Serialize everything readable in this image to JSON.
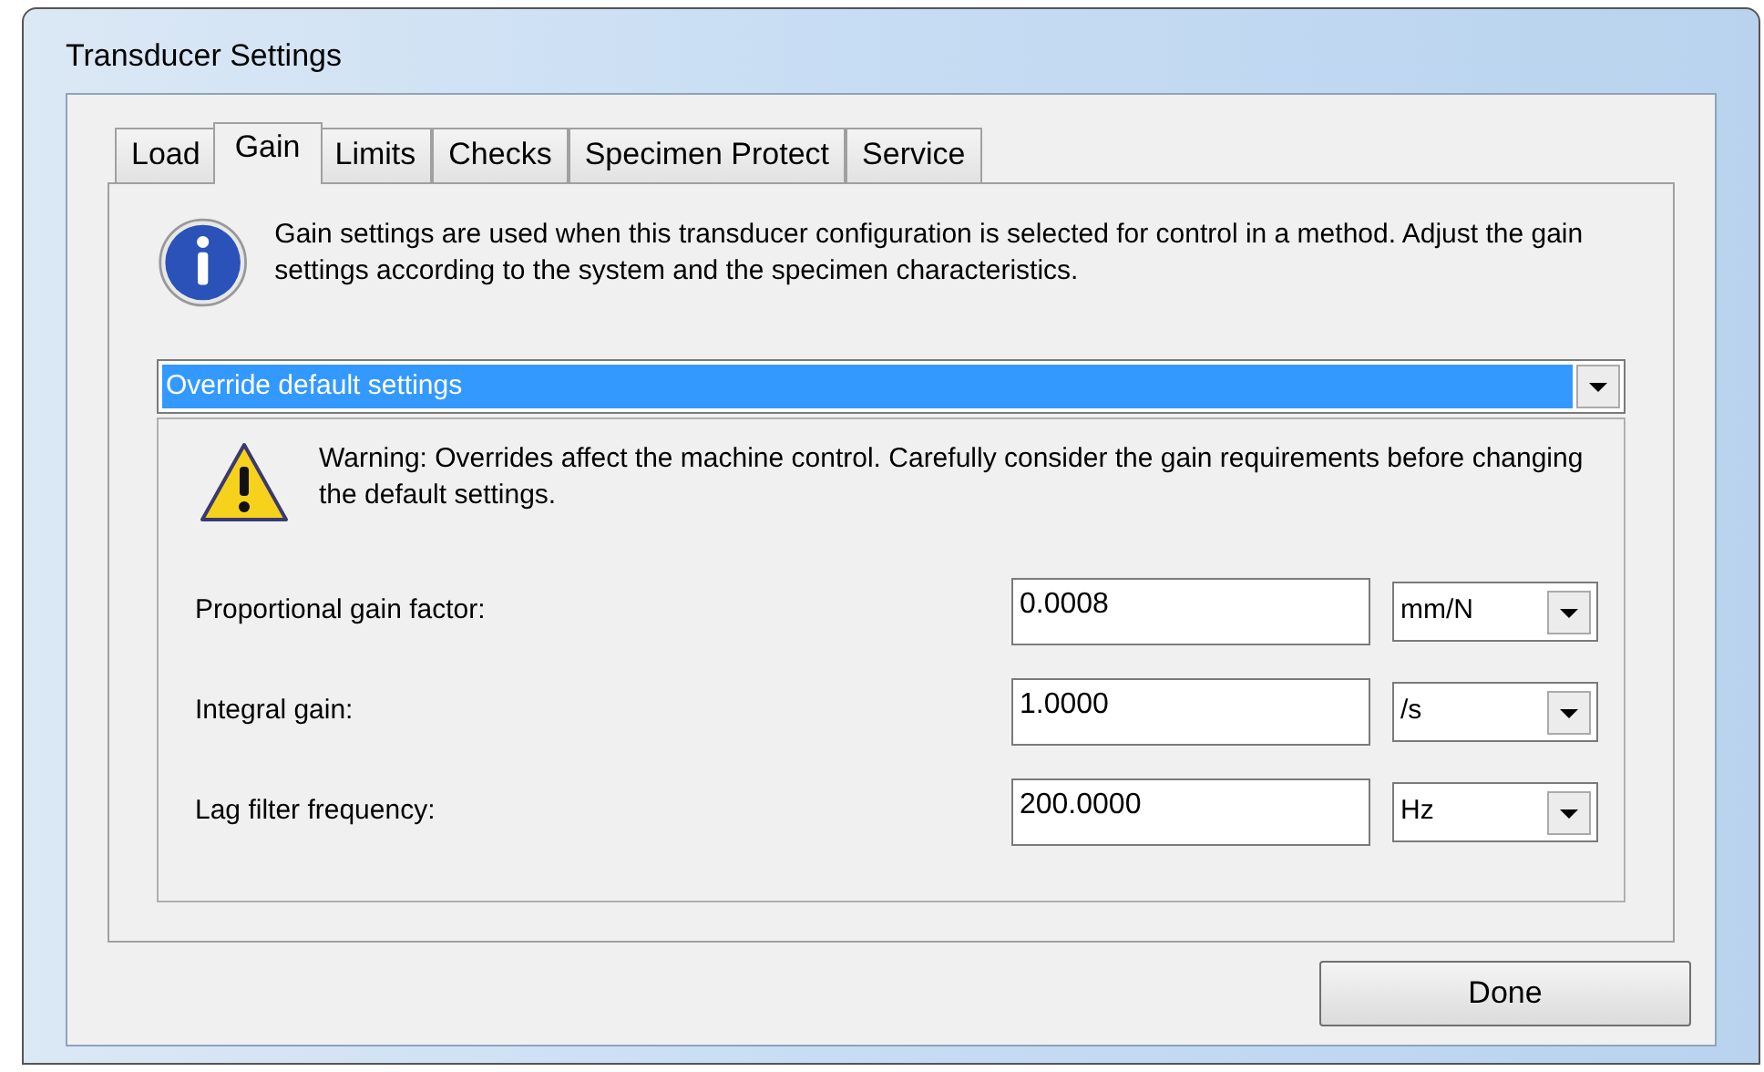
{
  "window": {
    "title": "Transducer Settings"
  },
  "tabs": [
    {
      "label": "Load",
      "selected": false
    },
    {
      "label": "Gain",
      "selected": true
    },
    {
      "label": "Limits",
      "selected": false
    },
    {
      "label": "Checks",
      "selected": false
    },
    {
      "label": "Specimen Protect",
      "selected": false
    },
    {
      "label": "Service",
      "selected": false
    }
  ],
  "info": "Gain settings are used when this transducer configuration is selected for control in a method. Adjust the gain settings according to the system and the specimen characteristics.",
  "mode_dropdown": {
    "value": "Override default settings",
    "selected": true
  },
  "warning": "Warning: Overrides affect the machine control. Carefully consider the gain requirements before changing the default settings.",
  "fields": [
    {
      "label": "Proportional gain factor:",
      "value": "0.0008",
      "unit": "mm/N"
    },
    {
      "label": "Integral gain:",
      "value": "1.0000",
      "unit": "/s"
    },
    {
      "label": "Lag filter frequency:",
      "value": "200.0000",
      "unit": "Hz"
    }
  ],
  "buttons": [
    "Done"
  ]
}
